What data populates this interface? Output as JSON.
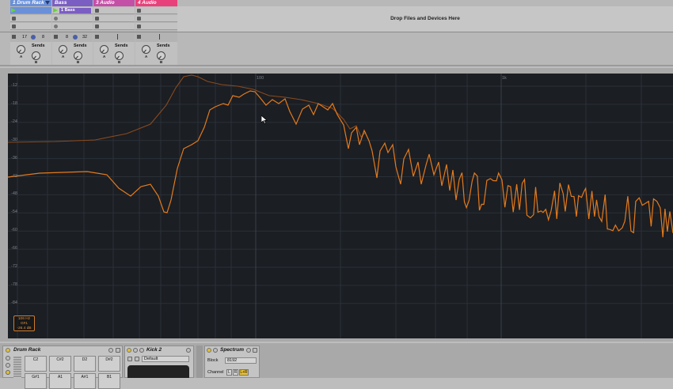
{
  "tracks": [
    {
      "name": "1 Drum Rack",
      "color": "#6a90d8"
    },
    {
      "name": "Bass",
      "color": "#7b5ec2"
    },
    {
      "name": "3 Audio",
      "color": "#c44fa6"
    },
    {
      "name": "4 Audio",
      "color": "#e8407a"
    }
  ],
  "clips": {
    "bass_clip": "1 Bass"
  },
  "dropzone": "Drop Files and Devices Here",
  "io_values": {
    "drum_a": "17",
    "drum_b": "8",
    "bass_a": "8",
    "bass_b": "32"
  },
  "sends_label": "Sends",
  "knob_a": "A",
  "knob_b": "B",
  "spectrum": {
    "y_labels": [
      "-12",
      "-18",
      "-24",
      "-30",
      "-36",
      "-42",
      "-48",
      "-54",
      "-60",
      "-66",
      "-72",
      "-78",
      "-84"
    ],
    "x_labels": [
      "100",
      "1k"
    ],
    "readout": [
      "106 Hz",
      "G#1",
      "-26.4 dB"
    ],
    "colors": {
      "live": "#e47a1c",
      "peak": "#8a4a1e",
      "grid": "#2b3038"
    }
  },
  "devices": {
    "drum_rack": {
      "title": "Drum Rack",
      "pads": [
        "C2",
        "C#2",
        "D2",
        "D#2",
        "G#1",
        "A1",
        "A#1",
        "B1"
      ]
    },
    "kick": {
      "title": "Kick 2",
      "preset": "Default"
    },
    "spectrum_device": {
      "title": "Spectrum",
      "block_label": "Block",
      "block_value": "8192",
      "channel_label": "Channel",
      "channel_opts": [
        "L",
        "R",
        "L+R"
      ]
    }
  }
}
